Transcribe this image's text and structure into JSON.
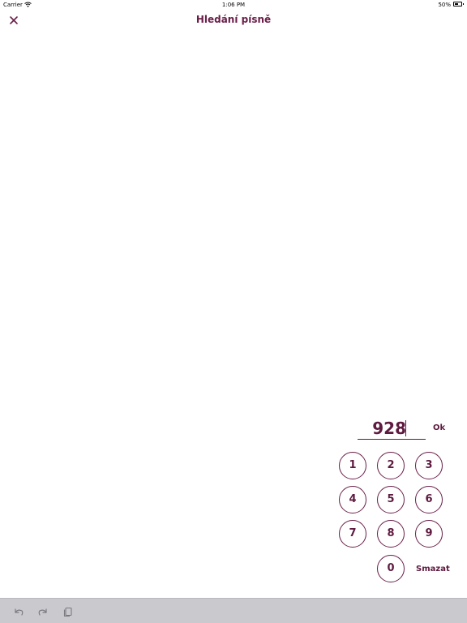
{
  "status": {
    "carrier": "Carrier",
    "time": "1:06 PM",
    "battery": "50%"
  },
  "nav": {
    "title": "Hledání písně",
    "close_icon": "close-icon"
  },
  "search": {
    "value": "928",
    "ok_label": "Ok"
  },
  "keypad": {
    "keys": [
      "1",
      "2",
      "3",
      "4",
      "5",
      "6",
      "7",
      "8",
      "9",
      "0"
    ],
    "delete_label": "Smazat"
  },
  "toolbar": {
    "icons": [
      "undo-icon",
      "redo-icon",
      "clipboard-icon"
    ]
  },
  "colors": {
    "accent": "#5e1a3f",
    "toolbar_bg": "#c9c9ce"
  }
}
